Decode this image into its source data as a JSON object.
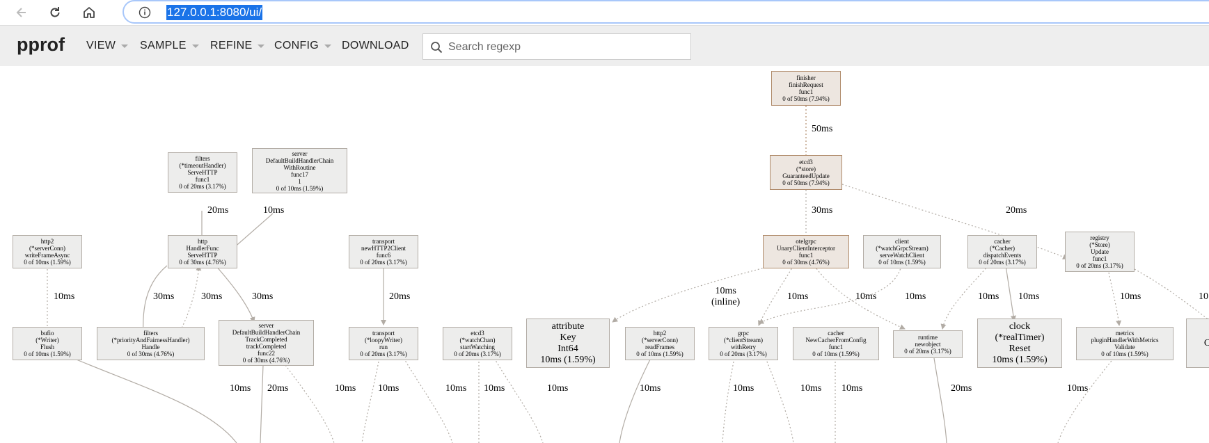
{
  "browser": {
    "url": "127.0.0.1:8080/ui/",
    "icons": [
      "back-icon",
      "reload-icon",
      "home-icon",
      "info-icon"
    ]
  },
  "app": {
    "title": "pprof",
    "menus": [
      {
        "label": "VIEW",
        "dropdown": true
      },
      {
        "label": "SAMPLE",
        "dropdown": true
      },
      {
        "label": "REFINE",
        "dropdown": true
      },
      {
        "label": "CONFIG",
        "dropdown": true
      },
      {
        "label": "DOWNLOAD",
        "dropdown": false
      }
    ],
    "search": {
      "placeholder": "Search regexp",
      "value": ""
    }
  },
  "graph": {
    "nodes": [
      {
        "id": "finisher",
        "lines": [
          "finisher",
          "finishRequest",
          "func1",
          "0 of 50ms (7.94%)"
        ]
      },
      {
        "id": "etcd3-store",
        "lines": [
          "etcd3",
          "(*store)",
          "GuaranteedUpdate",
          "0 of 50ms (7.94%)"
        ]
      },
      {
        "id": "filters-timeout",
        "lines": [
          "filters",
          "(*timeoutHandler)",
          "ServeHTTP",
          "func1",
          "0 of 20ms (3.17%)"
        ]
      },
      {
        "id": "server-handlerchain",
        "lines": [
          "server",
          "DefaultBuildHandlerChain",
          "WithRoutine",
          "func17",
          "1",
          "0 of 10ms (1.59%)"
        ]
      },
      {
        "id": "http2-serverconn-write",
        "lines": [
          "http2",
          "(*serverConn)",
          "writeFrameAsync",
          "0 of 10ms (1.59%)"
        ]
      },
      {
        "id": "http-handlerfunc",
        "lines": [
          "http",
          "HandlerFunc",
          "ServeHTTP",
          "0 of 30ms (4.76%)"
        ]
      },
      {
        "id": "transport-newhttp2",
        "lines": [
          "transport",
          "newHTTP2Client",
          "func6",
          "0 of 20ms (3.17%)"
        ]
      },
      {
        "id": "otelgrpc",
        "lines": [
          "otelgrpc",
          "UnaryClientInterceptor",
          "func1",
          "0 of 30ms (4.76%)"
        ]
      },
      {
        "id": "client-watchgrpc",
        "lines": [
          "client",
          "(*watchGrpcStream)",
          "serveWatchClient",
          "0 of 10ms (1.59%)"
        ]
      },
      {
        "id": "cacher-dispatch",
        "lines": [
          "cacher",
          "(*Cacher)",
          "dispatchEvents",
          "0 of 20ms (3.17%)"
        ]
      },
      {
        "id": "registry-update",
        "lines": [
          "registry",
          "(*Store)",
          "Update",
          "func1",
          "0 of 20ms (3.17%)"
        ]
      },
      {
        "id": "bufio-flush",
        "lines": [
          "bufio",
          "(*Writer)",
          "Flush",
          "0 of 10ms (1.59%)"
        ]
      },
      {
        "id": "filters-priority",
        "lines": [
          "filters",
          "(*priorityAndFairnessHandler)",
          "Handle",
          "0 of 30ms (4.76%)"
        ]
      },
      {
        "id": "server-trackcompleted",
        "lines": [
          "server",
          "DefaultBuildHandlerChain",
          "TrackCompleted",
          "trackCompleted",
          "func22",
          "0 of 30ms (4.76%)"
        ]
      },
      {
        "id": "transport-loopywriter",
        "lines": [
          "transport",
          "(*loopyWriter)",
          "run",
          "0 of 20ms (3.17%)"
        ]
      },
      {
        "id": "etcd3-watchchan",
        "lines": [
          "etcd3",
          "(*watchChan)",
          "startWatching",
          "0 of 20ms (3.17%)"
        ]
      },
      {
        "id": "attribute-key",
        "lines": [
          "attribute",
          "Key",
          "Int64",
          "10ms (1.59%)"
        ]
      },
      {
        "id": "http2-readframes",
        "lines": [
          "http2",
          "(*serverConn)",
          "readFrames",
          "0 of 10ms (1.59%)"
        ]
      },
      {
        "id": "grpc-withretry",
        "lines": [
          "grpc",
          "(*clientStream)",
          "withRetry",
          "0 of 20ms (3.17%)"
        ]
      },
      {
        "id": "cacher-newcacher",
        "lines": [
          "cacher",
          "NewCacherFromConfig",
          "func1",
          "0 of 10ms (1.59%)"
        ]
      },
      {
        "id": "runtime-newobject",
        "lines": [
          "runtime",
          "newobject",
          "0 of 20ms (3.17%)"
        ]
      },
      {
        "id": "clock-reset",
        "lines": [
          "clock",
          "(*realTimer)",
          "Reset",
          "10ms (1.59%)"
        ]
      },
      {
        "id": "metrics-validate",
        "lines": [
          "metrics",
          "pluginHandlerWithMetrics",
          "Validate",
          "0 of 10ms (1.59%)"
        ]
      },
      {
        "id": "edge-node",
        "lines": [
          "C"
        ]
      }
    ],
    "edge_labels": [
      {
        "id": "e-finisher-etcd3",
        "text": "50ms"
      },
      {
        "id": "e-filters-http",
        "text": "20ms"
      },
      {
        "id": "e-server-http",
        "text": "10ms"
      },
      {
        "id": "e-etcd3-otel",
        "text": "30ms"
      },
      {
        "id": "e-etcd3-registry",
        "text": "20ms"
      },
      {
        "id": "e-http2-bufio",
        "text": "10ms"
      },
      {
        "id": "e-http-priority",
        "text": "30ms"
      },
      {
        "id": "e-priority-http",
        "text": "30ms"
      },
      {
        "id": "e-http-track",
        "text": "30ms"
      },
      {
        "id": "e-transport-loopy",
        "text": "20ms"
      },
      {
        "id": "e-otel-attr",
        "text": "10ms\n(inline)"
      },
      {
        "id": "e-otel-grpc",
        "text": "10ms"
      },
      {
        "id": "e-otel-runtime",
        "text": "10ms"
      },
      {
        "id": "e-client-grpc",
        "text": "10ms"
      },
      {
        "id": "e-cacher-runtime",
        "text": "10ms"
      },
      {
        "id": "e-cacher-clock",
        "text": "10ms"
      },
      {
        "id": "e-registry-metrics",
        "text": "10ms"
      },
      {
        "id": "e-registry-edge",
        "text": "10"
      },
      {
        "id": "b1",
        "text": "10ms"
      },
      {
        "id": "b2",
        "text": "20ms"
      },
      {
        "id": "b3",
        "text": "10ms"
      },
      {
        "id": "b4",
        "text": "10ms"
      },
      {
        "id": "b5",
        "text": "10ms"
      },
      {
        "id": "b6",
        "text": "10ms"
      },
      {
        "id": "b7",
        "text": "10ms"
      },
      {
        "id": "b8",
        "text": "10ms"
      },
      {
        "id": "b9",
        "text": "10ms"
      },
      {
        "id": "b10",
        "text": "10ms"
      },
      {
        "id": "b11",
        "text": "10ms"
      },
      {
        "id": "b12",
        "text": "20ms"
      },
      {
        "id": "b13",
        "text": "10ms"
      }
    ]
  }
}
